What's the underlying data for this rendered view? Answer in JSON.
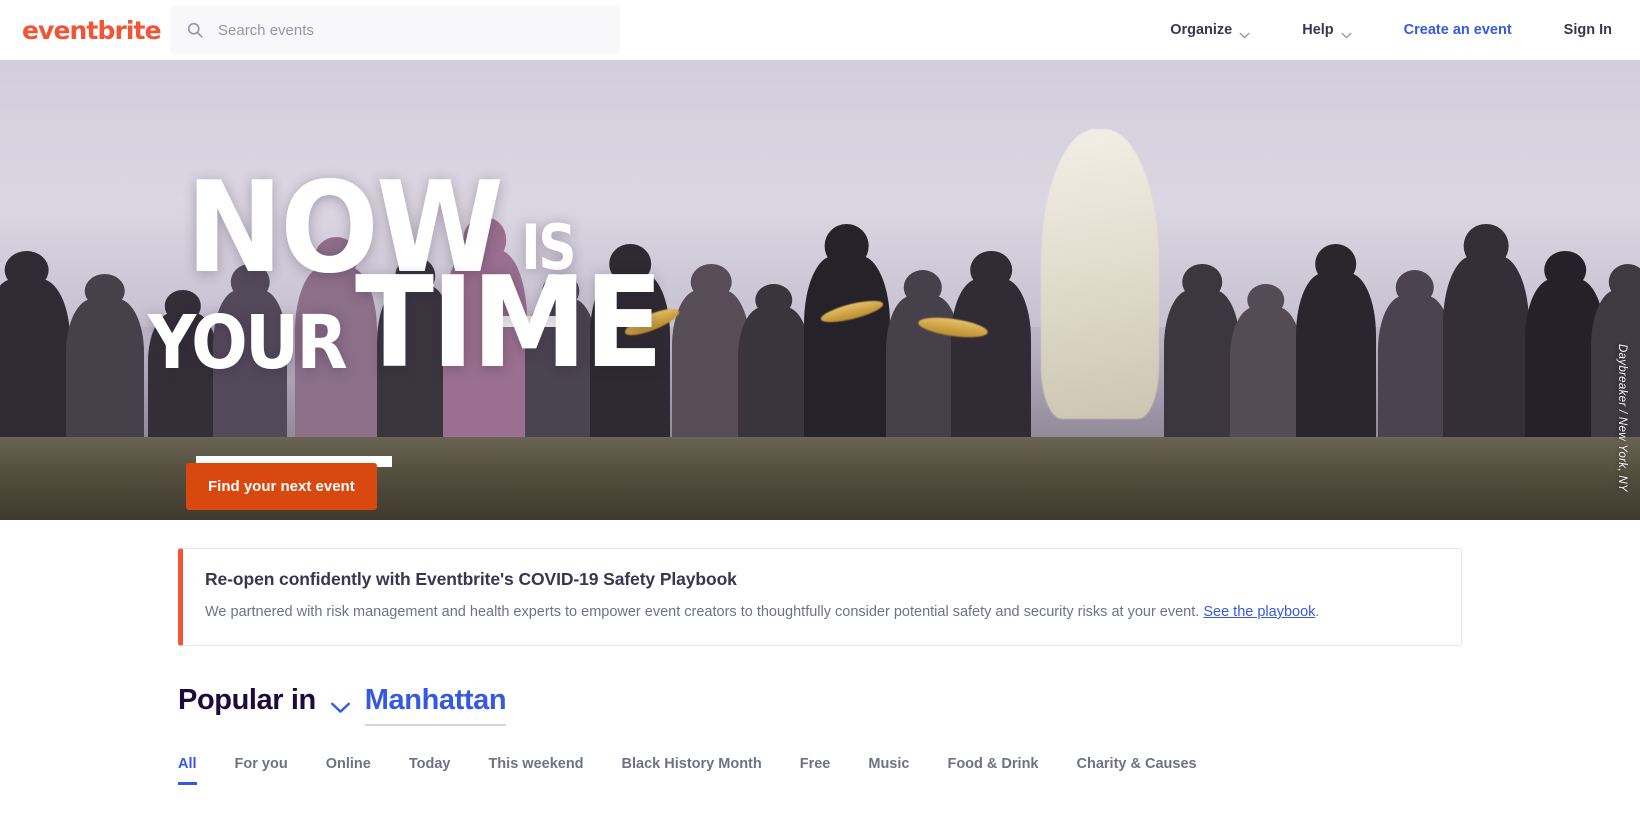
{
  "header": {
    "logo_text": "eventbrite",
    "logo_color": "#f05537",
    "search": {
      "placeholder": "Search events",
      "value": "",
      "icon": "search-icon"
    },
    "nav": [
      {
        "label": "Organize",
        "has_chevron": true,
        "style": "default"
      },
      {
        "label": "Help",
        "has_chevron": true,
        "style": "default"
      },
      {
        "label": "Create an event",
        "has_chevron": false,
        "style": "link"
      },
      {
        "label": "Sign In",
        "has_chevron": false,
        "style": "default"
      }
    ]
  },
  "hero": {
    "title_line1_a": "NOW",
    "title_line1_b": "IS",
    "title_line2_a": "YOUR",
    "title_line2_b": "TIME",
    "cta_label": "Find your next event",
    "cta_color": "#d9480f",
    "photo_credit": "Daybreaker / New York, NY"
  },
  "banner": {
    "headline": "Re-open confidently with Eventbrite's COVID-19 Safety Playbook",
    "body_before": "We partnered with risk management and health experts to empower event creators to thoughtfully consider potential safety and security risks at your event. ",
    "link_label": "See the playbook",
    "body_after": ".",
    "accent_color": "#f05537"
  },
  "popular": {
    "label": "Popular in",
    "city": "Manhattan",
    "chevron_icon": "chevron-down-icon",
    "accent_color": "#3659e3"
  },
  "tabs": [
    {
      "label": "All",
      "active": true
    },
    {
      "label": "For you",
      "active": false
    },
    {
      "label": "Online",
      "active": false
    },
    {
      "label": "Today",
      "active": false
    },
    {
      "label": "This weekend",
      "active": false
    },
    {
      "label": "Black History Month",
      "active": false
    },
    {
      "label": "Free",
      "active": false
    },
    {
      "label": "Music",
      "active": false
    },
    {
      "label": "Food & Drink",
      "active": false
    },
    {
      "label": "Charity & Causes",
      "active": false
    }
  ]
}
